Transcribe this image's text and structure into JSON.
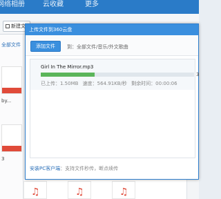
{
  "app": {
    "nav": {
      "items": [
        {
          "label": "网络相册"
        },
        {
          "label": "云收藏"
        },
        {
          "label": "更多"
        }
      ]
    },
    "toolbar": {
      "new_folder_label": "新建文件夹"
    },
    "sidebar": {
      "breadcrumb": "全部文件"
    },
    "files": [
      {
        "label": "by..."
      },
      {
        "label": "3"
      }
    ]
  },
  "dialog": {
    "title": "上传文件到360云盘",
    "add_file_label": "添加文件",
    "destination_label": "到：全部文件/音乐/外文歌曲",
    "upload": {
      "file_name": "Girl In The Mirror.mp3",
      "progress": 0.35,
      "percent_text": "3",
      "uploaded": "已上传：1.50MB",
      "speed": "速度：564.91KB/秒",
      "remaining": "剩余时间：00:00:06"
    },
    "footer": {
      "link": "安装PC客户端",
      "text": "：支持文件秒传，断点续传"
    }
  },
  "colors": {
    "accent": "#3a8fde",
    "progress": "#5bb55a",
    "file_badge": "#e04b3a"
  }
}
